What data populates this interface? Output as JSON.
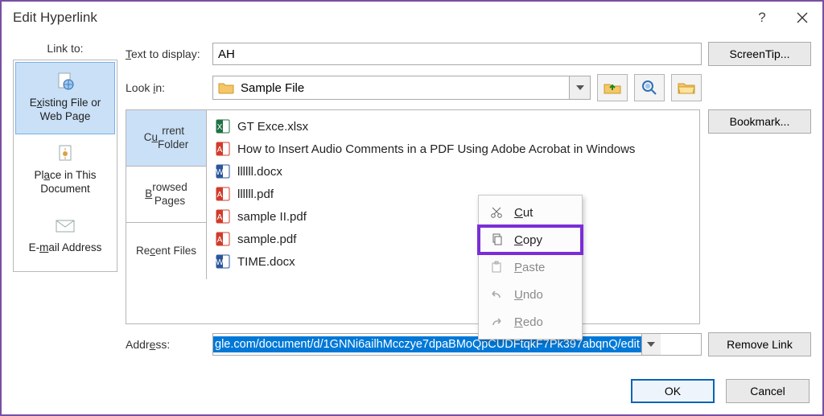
{
  "window": {
    "title": "Edit Hyperlink"
  },
  "linkto": {
    "label": "Link to:",
    "items": [
      {
        "lines": [
          "Existing File or",
          "Web Page"
        ],
        "label": "Existing File or Web Page",
        "icon": "globe-page-icon"
      },
      {
        "lines": [
          "Place in This",
          "Document"
        ],
        "label": "Place in This Document",
        "icon": "doc-place-icon"
      },
      {
        "lines": [
          "E-mail Address"
        ],
        "label": "E-mail Address",
        "icon": "mail-icon"
      }
    ],
    "selected_index": 0
  },
  "text_to_display": {
    "label": "Text to display:",
    "value": "AH"
  },
  "look_in": {
    "label": "Look in:",
    "value": "Sample File"
  },
  "browse_tabs": {
    "items": [
      "Current Folder",
      "Browsed Pages",
      "Recent Files"
    ],
    "selected_index": 0
  },
  "files": [
    {
      "name": "GT Exce.xlsx",
      "type": "xlsx"
    },
    {
      "name": "How to Insert Audio Comments in a PDF Using Adobe Acrobat in Windows",
      "type": "pdf"
    },
    {
      "name": "llllll.docx",
      "type": "docx"
    },
    {
      "name": "llllll.pdf",
      "type": "pdf"
    },
    {
      "name": "sample II.pdf",
      "type": "pdf"
    },
    {
      "name": "sample.pdf",
      "type": "pdf"
    },
    {
      "name": "TIME.docx",
      "type": "docx"
    }
  ],
  "address": {
    "label": "Address:",
    "value": "gle.com/document/d/1GNNi6ailhMcczye7dpaBMoQpCUDFtqkF7Pk397abqnQ/edit"
  },
  "buttons": {
    "screentip": "ScreenTip...",
    "bookmark": "Bookmark...",
    "remove": "Remove Link",
    "ok": "OK",
    "cancel": "Cancel"
  },
  "context_menu": {
    "items": [
      {
        "label": "Cut",
        "icon": "scissors-icon",
        "enabled": true,
        "highlight": false
      },
      {
        "label": "Copy",
        "icon": "copy-icon",
        "enabled": true,
        "highlight": true
      },
      {
        "label": "Paste",
        "icon": "paste-icon",
        "enabled": false,
        "highlight": false
      },
      {
        "label": "Undo",
        "icon": "undo-icon",
        "enabled": false,
        "highlight": false
      },
      {
        "label": "Redo",
        "icon": "redo-icon",
        "enabled": false,
        "highlight": false
      }
    ]
  },
  "file_icon_colors": {
    "xlsx": "#1f7244",
    "pdf": "#d13b2a",
    "docx": "#2b579a"
  }
}
